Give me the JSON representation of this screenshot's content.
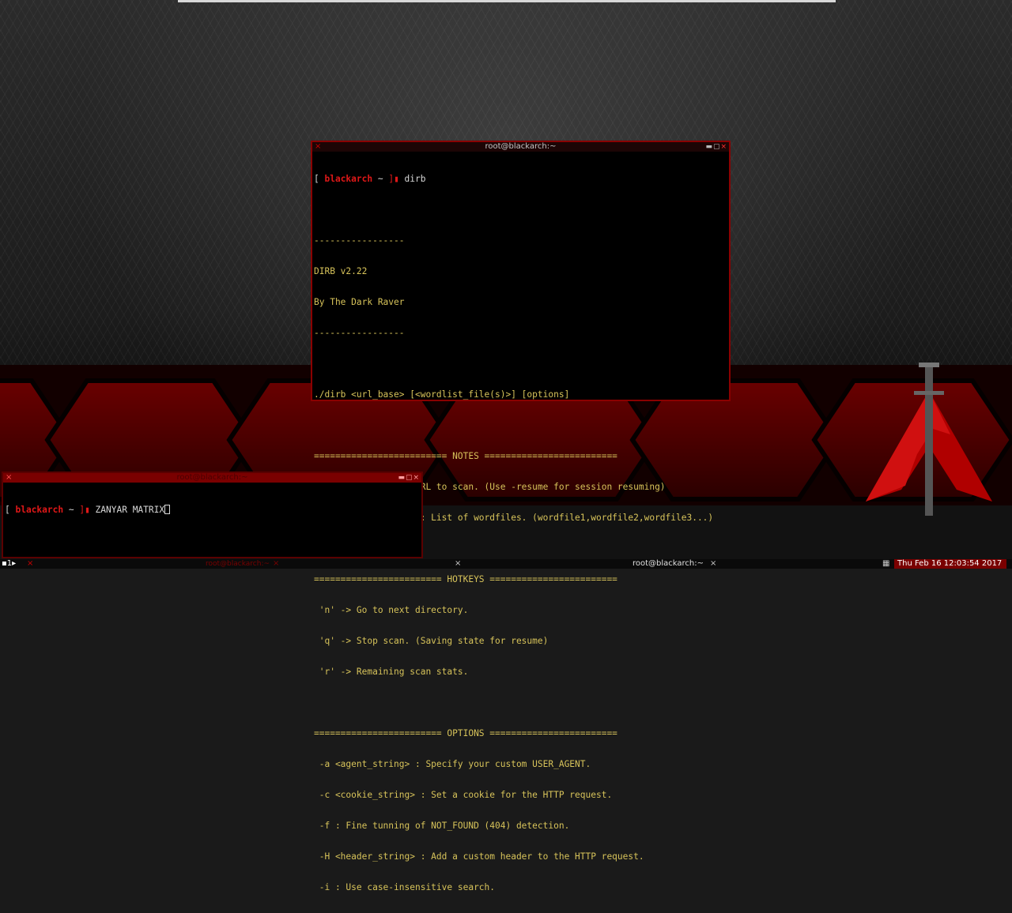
{
  "main_terminal": {
    "title": "root@blackarch:~",
    "prompt": {
      "open": "[ ",
      "host": "blackarch",
      "tilde": " ~ ",
      "sep": "]▮ "
    },
    "command": "dirb",
    "lines": [
      "",
      "-----------------",
      "DIRB v2.22",
      "By The Dark Raver",
      "-----------------",
      "",
      "./dirb <url_base> [<wordlist_file(s)>] [options]",
      "",
      "========================= NOTES =========================",
      " <url_base> : Base URL to scan. (Use -resume for session resuming)",
      " <wordlist_file(s)> : List of wordfiles. (wordfile1,wordfile2,wordfile3...)",
      "",
      "======================== HOTKEYS ========================",
      " 'n' -> Go to next directory.",
      " 'q' -> Stop scan. (Saving state for resume)",
      " 'r' -> Remaining scan stats.",
      "",
      "======================== OPTIONS ========================",
      " -a <agent_string> : Specify your custom USER_AGENT.",
      " -c <cookie_string> : Set a cookie for the HTTP request.",
      " -f : Fine tunning of NOT_FOUND (404) detection.",
      " -H <header_string> : Add a custom header to the HTTP request.",
      " -i : Use case-insensitive search."
    ]
  },
  "small_terminal": {
    "title": "root@blackarch:~",
    "prompt": {
      "open": "[ ",
      "host": "blackarch",
      "tilde": " ~ ",
      "sep": "]▮ "
    },
    "input_text": "ZANYAR MATRIX"
  },
  "taskbar": {
    "workspace": "▪1▸",
    "window1_title": "root@blackarch:~",
    "window2_title": "root@blackarch:~",
    "clock": "Thu Feb 16 12:03:54 2017"
  },
  "icons": {
    "close": "×",
    "window_buttons": "▬▢",
    "tray": "▦"
  },
  "colors": {
    "accent": "#8a0000",
    "prompt_host": "#e01818",
    "terminal_text": "#d7c35a",
    "background": "#1a1a1a"
  }
}
